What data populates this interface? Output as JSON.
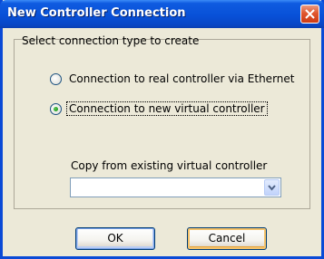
{
  "window": {
    "title": "New Controller Connection"
  },
  "group": {
    "label": "Select connection type to create"
  },
  "options": [
    {
      "label": "Connection to real controller via Ethernet",
      "selected": false
    },
    {
      "label": "Connection to new virtual controller",
      "selected": true
    }
  ],
  "copy_from": {
    "label": "Copy from existing virtual controller",
    "value": ""
  },
  "buttons": {
    "ok_label": "OK",
    "cancel_label": "Cancel"
  },
  "icons": {
    "close": "close-icon",
    "dropdown": "chevron-down-icon"
  },
  "colors": {
    "titlebar": "#0a4ad6",
    "close_button": "#e0572f",
    "radio_selected": "#21a121"
  }
}
